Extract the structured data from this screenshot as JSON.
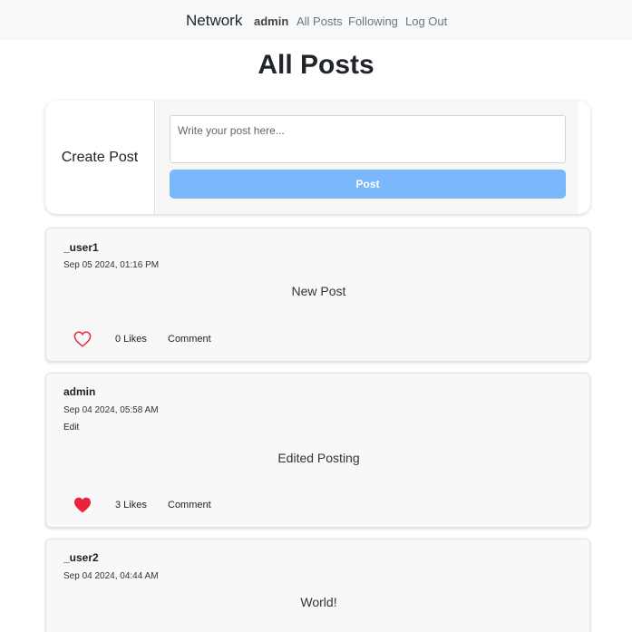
{
  "nav": {
    "brand": "Network",
    "user": "admin",
    "links": [
      "All Posts",
      "Following",
      "Log Out"
    ]
  },
  "page": {
    "title": "All Posts"
  },
  "create_post": {
    "label": "Create Post",
    "placeholder": "Write your post here...",
    "button": "Post"
  },
  "posts": [
    {
      "username": "_user1",
      "timestamp": "Sep 05 2024, 01:16 PM",
      "content": "New Post",
      "likes": "0 Likes",
      "comment": "Comment",
      "liked": false
    },
    {
      "username": "admin",
      "timestamp": "Sep 04 2024, 05:58 AM",
      "edit": "Edit",
      "content": "Edited Posting",
      "likes": "3 Likes",
      "comment": "Comment",
      "liked": true
    },
    {
      "username": "_user2",
      "timestamp": "Sep 04 2024, 04:44 AM",
      "content": "World!"
    }
  ],
  "colors": {
    "accent": "#7ab8fb",
    "heart": "#e8243c",
    "navbar": "#f8f9fa"
  }
}
